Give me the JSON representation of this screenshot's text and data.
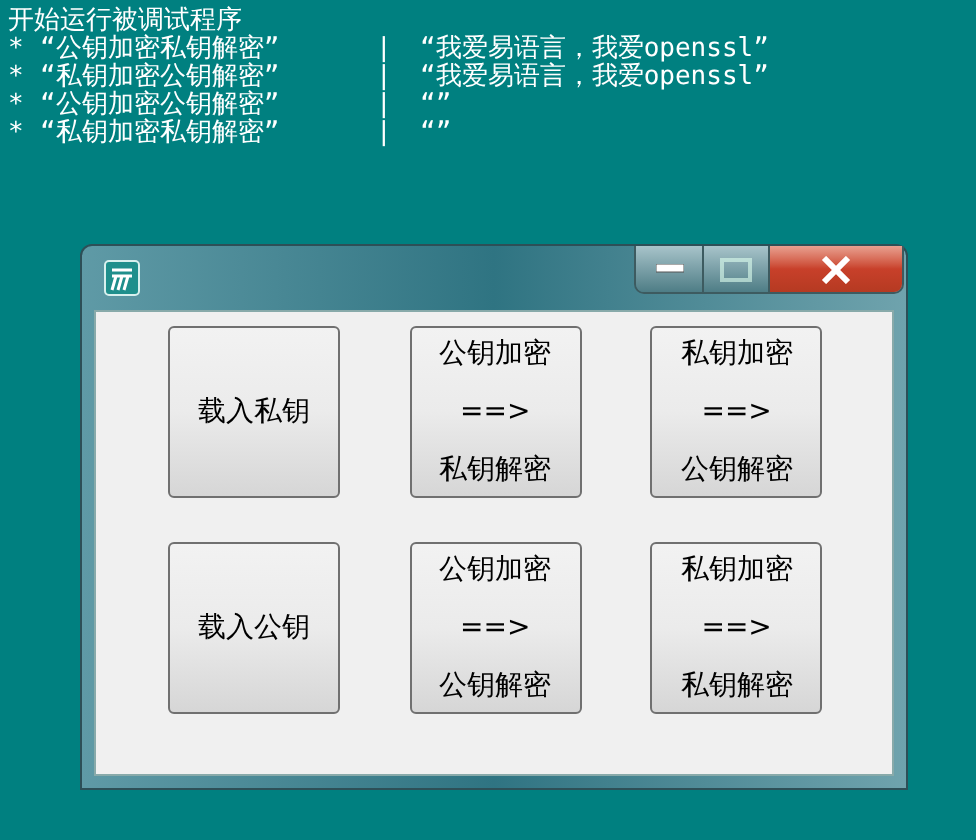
{
  "console": {
    "lines": [
      "开始运行被调试程序"
    ],
    "rows": [
      {
        "marker": "*",
        "name": "“公钥加密私钥解密”",
        "separator": "|",
        "value": "“我爱易语言，我爱openssl”"
      },
      {
        "marker": "*",
        "name": "“私钥加密公钥解密”",
        "separator": "|",
        "value": "“我爱易语言，我爱openssl”"
      },
      {
        "marker": "*",
        "name": "“公钥加密公钥解密”",
        "separator": "|",
        "value": "“”"
      },
      {
        "marker": "*",
        "name": "“私钥加密私钥解密”",
        "separator": "|",
        "value": "“”"
      }
    ]
  },
  "window": {
    "buttons": [
      {
        "lines": [
          "载入私钥"
        ]
      },
      {
        "lines": [
          "公钥加密",
          "==>",
          "私钥解密"
        ]
      },
      {
        "lines": [
          "私钥加密",
          "==>",
          "公钥解密"
        ]
      },
      {
        "lines": [
          "载入公钥"
        ]
      },
      {
        "lines": [
          "公钥加密",
          "==>",
          "公钥解密"
        ]
      },
      {
        "lines": [
          "私钥加密",
          "==>",
          "私钥解密"
        ]
      }
    ]
  }
}
